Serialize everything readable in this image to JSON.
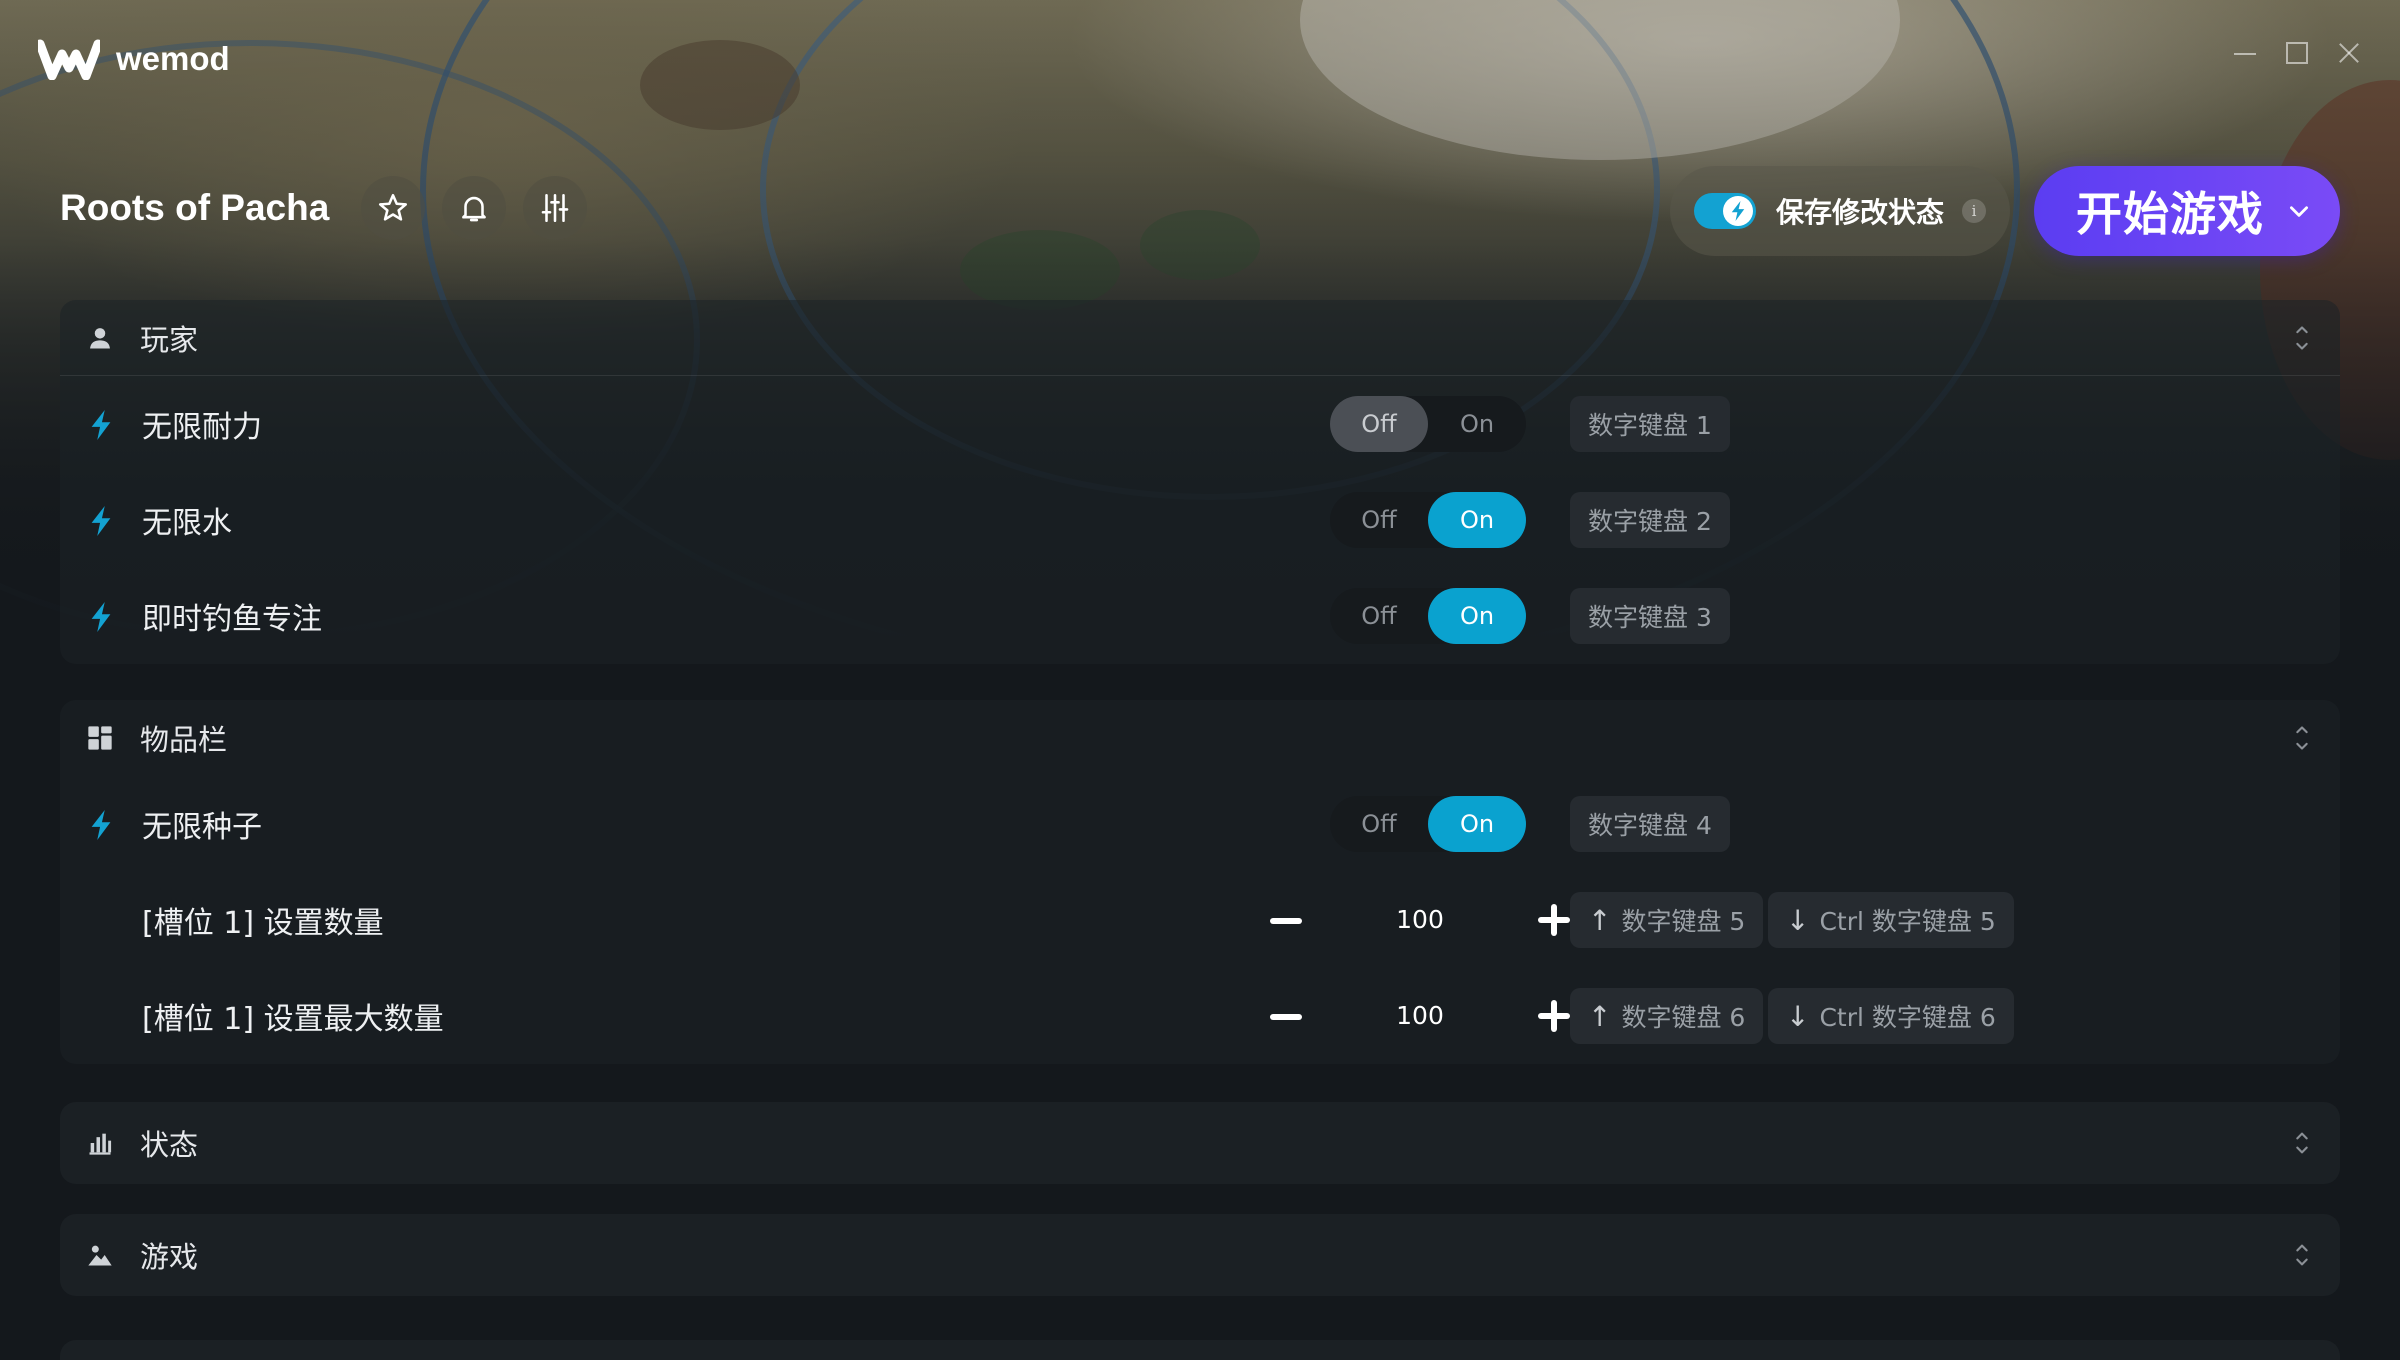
{
  "app": {
    "name": "wemod"
  },
  "game": {
    "title": "Roots of Pacha"
  },
  "header": {
    "save_mods_label": "保存修改状态",
    "save_mods_enabled": true,
    "info_glyph": "i",
    "play_label": "开始游戏"
  },
  "colors": {
    "accent": "#0aa2cf",
    "play": "#6a45f4"
  },
  "sections": [
    {
      "title": "玩家",
      "icon": "person-icon",
      "expanded": true,
      "rows": [
        {
          "label": "无限耐力",
          "type": "toggle",
          "state": "Off",
          "off_label": "Off",
          "on_label": "On",
          "hotkey": "数字键盘 1"
        },
        {
          "label": "无限水",
          "type": "toggle",
          "state": "On",
          "off_label": "Off",
          "on_label": "On",
          "hotkey": "数字键盘 2"
        },
        {
          "label": "即时钓鱼专注",
          "type": "toggle",
          "state": "On",
          "off_label": "Off",
          "on_label": "On",
          "hotkey": "数字键盘 3"
        }
      ]
    },
    {
      "title": "物品栏",
      "icon": "grid-icon",
      "expanded": true,
      "rows": [
        {
          "label": "无限种子",
          "type": "toggle",
          "state": "On",
          "off_label": "Off",
          "on_label": "On",
          "hotkey": "数字键盘 4"
        },
        {
          "label": "[槽位 1] 设置数量",
          "type": "number",
          "value": "100",
          "hotkey_up": "数字键盘 5",
          "hotkey_down": "Ctrl 数字键盘 5"
        },
        {
          "label": "[槽位 1] 设置最大数量",
          "type": "number",
          "value": "100",
          "hotkey_up": "数字键盘 6",
          "hotkey_down": "Ctrl 数字键盘 6"
        }
      ]
    },
    {
      "title": "状态",
      "icon": "bar-chart-icon",
      "expanded": false
    },
    {
      "title": "游戏",
      "icon": "landscape-icon",
      "expanded": false
    }
  ]
}
